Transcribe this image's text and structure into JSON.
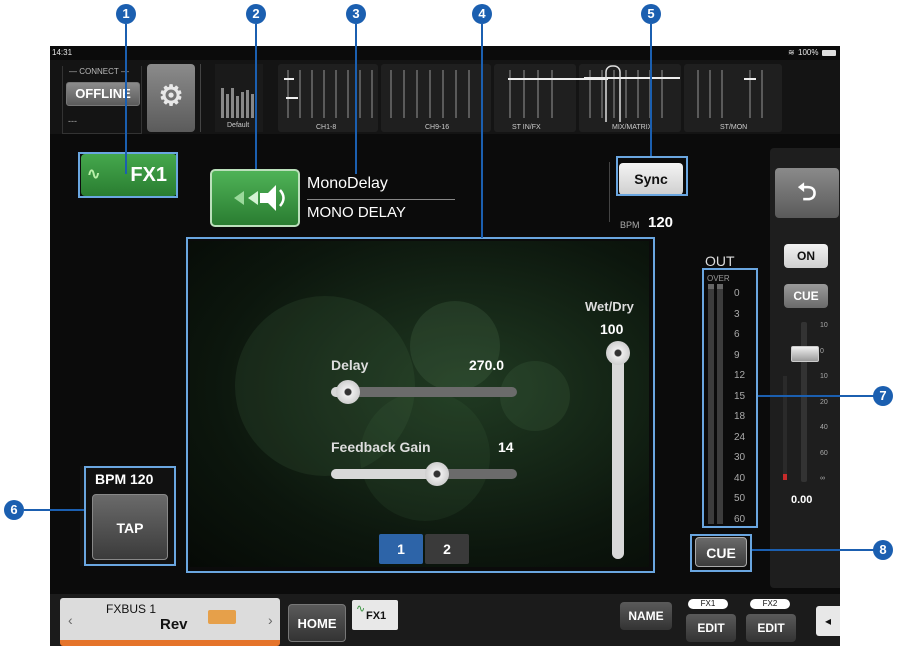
{
  "callouts": [
    "1",
    "2",
    "3",
    "4",
    "5",
    "6",
    "7",
    "8"
  ],
  "status": {
    "time": "14:31",
    "battery": "100%"
  },
  "connect": {
    "label": "CONNECT",
    "mode": "OFFLINE",
    "value": "---"
  },
  "scene": {
    "label": "Default"
  },
  "nav_tabs": [
    "CH1-8",
    "CH9-16",
    "ST IN/FX",
    "MIX/MATRIX",
    "ST/MON"
  ],
  "fx": {
    "slot": "FX1",
    "effect_name": "MonoDelay",
    "effect_type": "MONO DELAY",
    "sync_label": "Sync",
    "bpm_label": "BPM",
    "bpm_value": "120"
  },
  "params": {
    "delay_label": "Delay",
    "delay_value": "270.0",
    "delay_level": 0.03,
    "feedback_label": "Feedback Gain",
    "feedback_value": "14",
    "feedback_level": 0.58,
    "wetdry_label": "Wet/Dry",
    "wetdry_value": "100",
    "wetdry_level": 1.0,
    "pages": [
      "1",
      "2"
    ],
    "active_page": "1"
  },
  "tap": {
    "bpm": "BPM 120",
    "label": "TAP"
  },
  "out": {
    "label": "OUT",
    "over": "OVER",
    "scale": [
      "0",
      "3",
      "6",
      "9",
      "12",
      "15",
      "18",
      "24",
      "30",
      "40",
      "50",
      "60"
    ],
    "cue_label": "CUE"
  },
  "channel": {
    "on_label": "ON",
    "cue_label": "CUE",
    "fader_scale": [
      "10",
      "0",
      "10",
      "20",
      "40",
      "60",
      "∞"
    ],
    "fader_value": "0.00"
  },
  "bottom": {
    "bus_name": "FXBUS 1",
    "bus_sub": "Rev",
    "home": "HOME",
    "fx_tab": "FX1",
    "name_btn": "NAME",
    "fx1_label": "FX1",
    "fx2_label": "FX2",
    "edit1": "EDIT",
    "edit2": "EDIT"
  },
  "colors": {
    "accent_blue": "#1b5fb0",
    "fx_green": "#2f8d37",
    "page_active": "#2d64a8"
  }
}
